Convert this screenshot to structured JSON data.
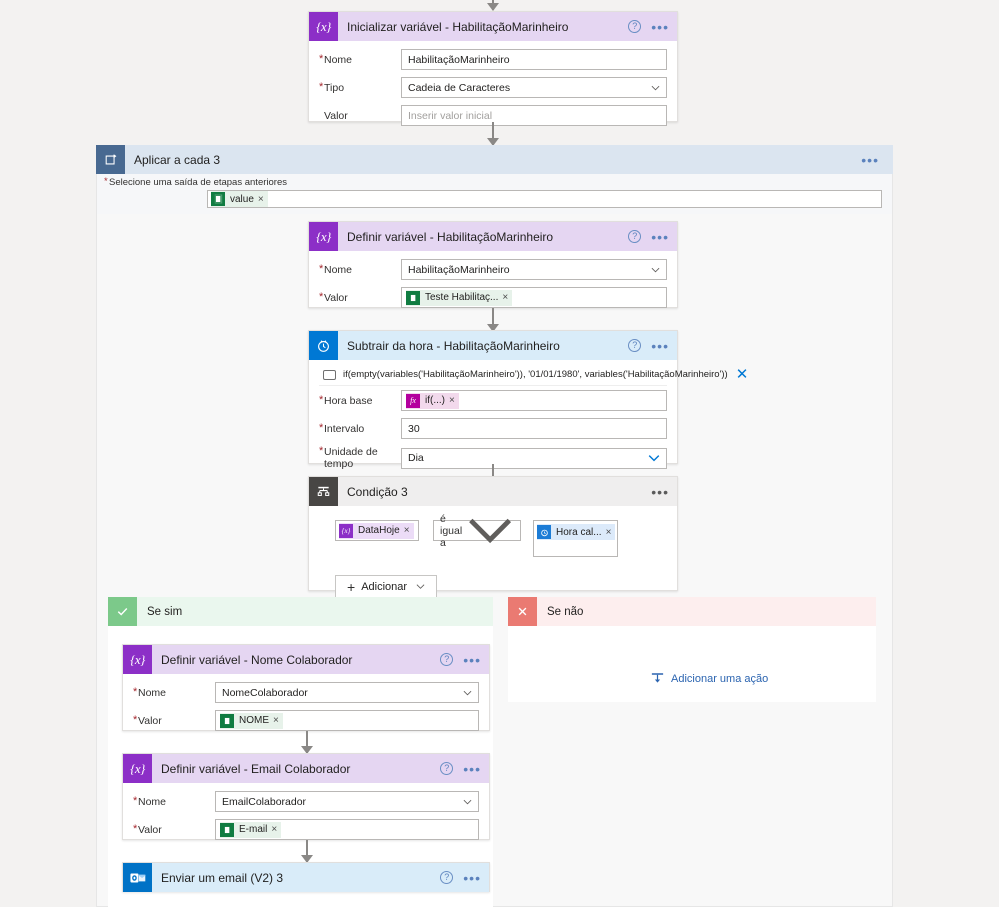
{
  "flow": {
    "steps": {
      "init_var": {
        "title": "Inicializar variável - HabilitaçãoMarinheiro",
        "icon": "variable-icon",
        "fields": [
          {
            "label": "Nome",
            "required": true,
            "value": "HabilitaçãoMarinheiro",
            "type": "text"
          },
          {
            "label": "Tipo",
            "required": true,
            "value": "Cadeia de Caracteres",
            "type": "select"
          },
          {
            "label": "Valor",
            "required": false,
            "value": "",
            "placeholder": "Inserir valor inicial",
            "type": "text"
          }
        ]
      },
      "loop": {
        "title": "Aplicar a cada 3",
        "icon": "loop-icon",
        "input_label": "Selecione uma saída de etapas anteriores",
        "input_token": {
          "text": "value",
          "icon": "excel-icon",
          "remove": "×"
        }
      },
      "set_var_hab": {
        "title": "Definir variável - HabilitaçãoMarinheiro",
        "icon": "variable-icon",
        "fields": [
          {
            "label": "Nome",
            "required": true,
            "value": "HabilitaçãoMarinheiro",
            "type": "select"
          },
          {
            "label": "Valor",
            "required": true,
            "type": "token",
            "token": {
              "text": "Teste Habilitaç...",
              "icon": "excel-icon",
              "remove": "×"
            }
          }
        ]
      },
      "subtract_time": {
        "title": "Subtrair da hora - HabilitaçãoMarinheiro",
        "icon": "clock-icon",
        "expression": "if(empty(variables('HabilitaçãoMarinheiro')), '01/01/1980', variables('HabilitaçãoMarinheiro'))",
        "expression_close": "✕",
        "fields": [
          {
            "label": "Hora base",
            "required": true,
            "type": "token",
            "token": {
              "text": "if(...)",
              "icon": "fx-icon",
              "remove": "×"
            }
          },
          {
            "label": "Intervalo",
            "required": true,
            "value": "30",
            "type": "text"
          },
          {
            "label": "Unidade de tempo",
            "required": true,
            "value": "Dia",
            "type": "select"
          }
        ]
      },
      "condition": {
        "title": "Condição 3",
        "icon": "condition-icon",
        "left_token": {
          "text": "DataHoje",
          "icon": "variable-icon",
          "remove": "×"
        },
        "operator": "é igual a",
        "right_token": {
          "text": "Hora cal...",
          "icon": "clock-icon",
          "remove": "×"
        },
        "add_button": "Adicionar"
      },
      "branch_yes": {
        "title": "Se sim",
        "icon": "check-icon"
      },
      "branch_no": {
        "title": "Se não",
        "icon": "close-icon",
        "add_action": "Adicionar uma ação",
        "add_action_icon": "add-action-icon"
      },
      "set_var_nome": {
        "title": "Definir variável - Nome Colaborador",
        "icon": "variable-icon",
        "fields": [
          {
            "label": "Nome",
            "required": true,
            "value": "NomeColaborador",
            "type": "select"
          },
          {
            "label": "Valor",
            "required": true,
            "type": "token",
            "token": {
              "text": "NOME",
              "icon": "excel-icon",
              "remove": "×"
            }
          }
        ]
      },
      "set_var_email": {
        "title": "Definir variável - Email Colaborador",
        "icon": "variable-icon",
        "fields": [
          {
            "label": "Nome",
            "required": true,
            "value": "EmailColaborador",
            "type": "select"
          },
          {
            "label": "Valor",
            "required": true,
            "type": "token",
            "token": {
              "text": "E-mail",
              "icon": "excel-icon",
              "remove": "×"
            }
          }
        ]
      },
      "send_email": {
        "title": "Enviar um email (V2) 3",
        "icon": "outlook-icon"
      }
    },
    "glyphs": {
      "variable": "{x}",
      "fx": "fx",
      "help": "?",
      "dots": "•••"
    },
    "colors": {
      "canvas": "#f3f2f1",
      "variable_purple": "#8c2fc7",
      "variable_header": "#e5d6f2",
      "clock_blue": "#0078d4",
      "clock_header": "#d9ecf9",
      "condition_dark": "#484644",
      "loop_blue": "#486991",
      "loop_header": "#dbe5f0",
      "yes_green": "#7cc98a",
      "no_red": "#ea7a72",
      "excel_green": "#107c41",
      "fx_magenta": "#b4009e",
      "link_blue": "#2b64b0",
      "required_red": "#a4262c"
    }
  }
}
